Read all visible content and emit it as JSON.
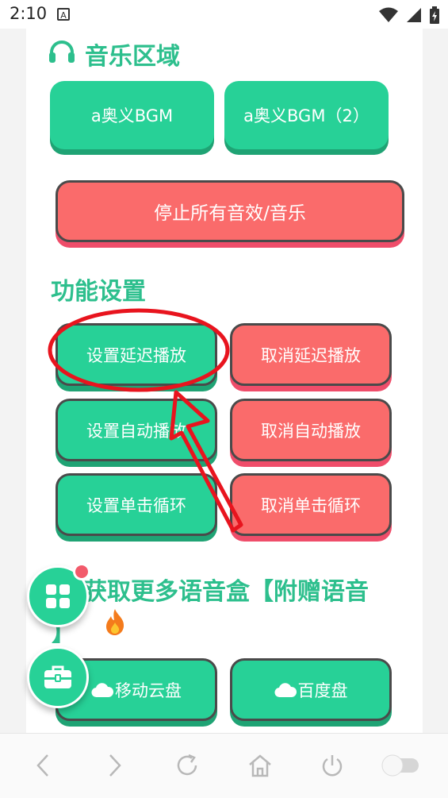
{
  "status": {
    "time": "2:10",
    "badge": "A"
  },
  "music_section": {
    "icon": "headphones-icon",
    "title": "音乐区域",
    "buttons": [
      "a奥义BGM",
      "a奥义BGM（2）"
    ],
    "stop_label": "停止所有音效/音乐"
  },
  "settings_section": {
    "title": "功能设置",
    "set_delay": "设置延迟播放",
    "cancel_delay": "取消延迟播放",
    "set_auto": "设置自动播放",
    "cancel_auto": "取消自动播放",
    "set_loop": "设置单击循环",
    "cancel_loop": "取消单击循环"
  },
  "more_section": {
    "title_line1": "获取更多语音盒【附赠语音",
    "title_line2": "】",
    "fire_icon": "fire-icon",
    "mobile_cloud": "移动云盘",
    "baidu": "百度盘"
  },
  "colors": {
    "green": "#27d197",
    "red": "#fa6b6b",
    "title": "#2dbf8d",
    "annotation": "#e8141e"
  }
}
